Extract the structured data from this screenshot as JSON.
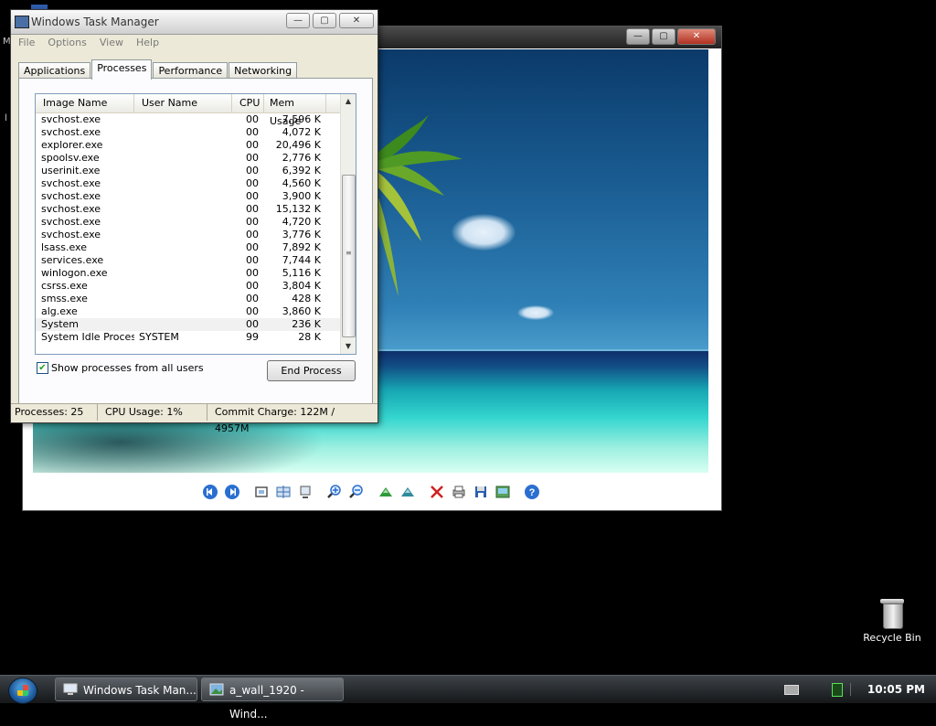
{
  "desktop": {
    "fragment_m": "M",
    "fragment_l": "l",
    "recycle_bin_label": "Recycle Bin"
  },
  "photo_viewer": {
    "close_glyph": "✕",
    "maximize_glyph": "▢",
    "minimize_glyph": "—",
    "toolbar_icons": [
      "previous-icon",
      "next-icon",
      "actual-size-icon",
      "slideshow-icon",
      "fit-icon",
      "zoom-in-icon",
      "zoom-out-icon",
      "rotate-cw-icon",
      "rotate-ccw-icon",
      "delete-icon",
      "print-icon",
      "save-icon",
      "edit-icon",
      "help-icon"
    ]
  },
  "task_manager": {
    "title": "Windows Task Manager",
    "menu": [
      "File",
      "Options",
      "View",
      "Help"
    ],
    "tabs": [
      {
        "label": "Applications",
        "active": false
      },
      {
        "label": "Processes",
        "active": true
      },
      {
        "label": "Performance",
        "active": false
      },
      {
        "label": "Networking",
        "active": false
      }
    ],
    "columns": {
      "image_name": "Image Name",
      "user_name": "User Name",
      "cpu": "CPU",
      "mem_usage": "Mem Usage"
    },
    "processes": [
      {
        "image": "svchost.exe",
        "user": "",
        "cpu": "00",
        "mem": "7,596 K"
      },
      {
        "image": "svchost.exe",
        "user": "",
        "cpu": "00",
        "mem": "4,072 K"
      },
      {
        "image": "explorer.exe",
        "user": "",
        "cpu": "00",
        "mem": "20,496 K"
      },
      {
        "image": "spoolsv.exe",
        "user": "",
        "cpu": "00",
        "mem": "2,776 K"
      },
      {
        "image": "userinit.exe",
        "user": "",
        "cpu": "00",
        "mem": "6,392 K"
      },
      {
        "image": "svchost.exe",
        "user": "",
        "cpu": "00",
        "mem": "4,560 K"
      },
      {
        "image": "svchost.exe",
        "user": "",
        "cpu": "00",
        "mem": "3,900 K"
      },
      {
        "image": "svchost.exe",
        "user": "",
        "cpu": "00",
        "mem": "15,132 K"
      },
      {
        "image": "svchost.exe",
        "user": "",
        "cpu": "00",
        "mem": "4,720 K"
      },
      {
        "image": "svchost.exe",
        "user": "",
        "cpu": "00",
        "mem": "3,776 K"
      },
      {
        "image": "lsass.exe",
        "user": "",
        "cpu": "00",
        "mem": "7,892 K"
      },
      {
        "image": "services.exe",
        "user": "",
        "cpu": "00",
        "mem": "7,744 K"
      },
      {
        "image": "winlogon.exe",
        "user": "",
        "cpu": "00",
        "mem": "5,116 K"
      },
      {
        "image": "csrss.exe",
        "user": "",
        "cpu": "00",
        "mem": "3,804 K"
      },
      {
        "image": "smss.exe",
        "user": "",
        "cpu": "00",
        "mem": "428 K"
      },
      {
        "image": "alg.exe",
        "user": "",
        "cpu": "00",
        "mem": "3,860 K"
      },
      {
        "image": "System",
        "user": "",
        "cpu": "00",
        "mem": "236 K"
      },
      {
        "image": "System Idle Process",
        "user": "SYSTEM",
        "cpu": "99",
        "mem": "28 K"
      }
    ],
    "show_all_label": "Show processes from all users",
    "show_all_checked": true,
    "end_process_label": "End Process",
    "status": {
      "processes": "Processes: 25",
      "cpu_usage": "CPU Usage: 1%",
      "commit_charge": "Commit Charge: 122M / 4957M"
    }
  },
  "taskbar": {
    "buttons": [
      {
        "label": "Windows Task Man...",
        "icon": "task-manager-icon",
        "active": false
      },
      {
        "label": "a_wall_1920 - Wind...",
        "icon": "photo-viewer-icon",
        "active": true
      }
    ],
    "clock": "10:05 PM"
  }
}
